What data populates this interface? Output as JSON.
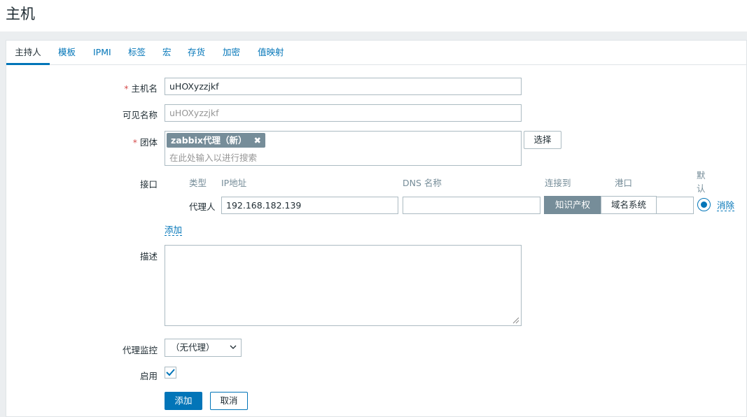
{
  "page": {
    "title": "主机"
  },
  "tabs": [
    {
      "label": "主持人"
    },
    {
      "label": "模板"
    },
    {
      "label": "IPMI"
    },
    {
      "label": "标签"
    },
    {
      "label": "宏"
    },
    {
      "label": "存货"
    },
    {
      "label": "加密"
    },
    {
      "label": "值映射"
    }
  ],
  "form": {
    "required_mark": "*",
    "host_name": {
      "label": "主机名",
      "value": "uHOXyzzjkf"
    },
    "visible_name": {
      "label": "可见名称",
      "placeholder": "uHOXyzzjkf"
    },
    "groups": {
      "label": "团体",
      "tag": "zabbix代理（新）",
      "remove_glyph": "✖",
      "placeholder": "在此处输入以进行搜索",
      "select_label": "选择"
    },
    "interfaces": {
      "label": "接口",
      "headers": {
        "type": "类型",
        "ip": "IP地址",
        "dns": "DNS 名称",
        "connect": "连接到",
        "port": "港口",
        "default": "默认"
      },
      "row": {
        "type": "代理人",
        "ip": "192.168.182.139",
        "dns": "",
        "connect_ip": "知识产权",
        "connect_dns": "域名系统",
        "port": "",
        "remove": "消除"
      },
      "add": "添加"
    },
    "description": {
      "label": "描述",
      "value": ""
    },
    "proxy": {
      "label": "代理监控",
      "value": "（无代理）"
    },
    "enabled": {
      "label": "启用",
      "checked": true
    },
    "buttons": {
      "add": "添加",
      "cancel": "取消"
    }
  },
  "colors": {
    "accent": "#0275b8",
    "required": "#d64e4e",
    "tag_bg": "#768d99"
  }
}
